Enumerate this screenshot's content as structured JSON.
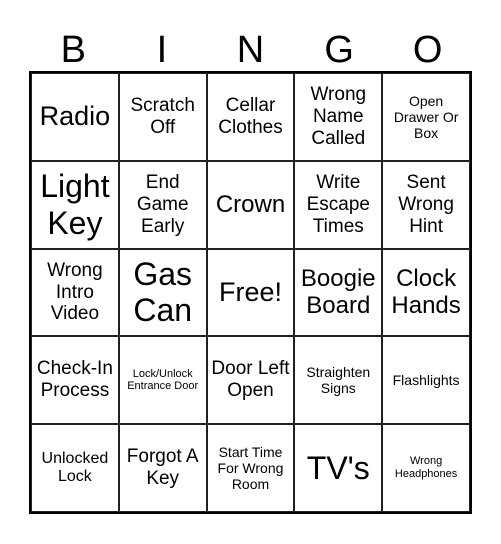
{
  "header": [
    "B",
    "I",
    "N",
    "G",
    "O"
  ],
  "cells": [
    [
      {
        "text": "Radio",
        "size": "s-l"
      },
      {
        "text": "Scratch Off",
        "size": "s-s"
      },
      {
        "text": "Cellar Clothes",
        "size": "s-s"
      },
      {
        "text": "Wrong Name Called",
        "size": "s-s"
      },
      {
        "text": "Open Drawer Or Box",
        "size": "s-xxs"
      }
    ],
    [
      {
        "text": "Light Key",
        "size": "s-xl"
      },
      {
        "text": "End Game Early",
        "size": "s-s"
      },
      {
        "text": "Crown",
        "size": "s-ml"
      },
      {
        "text": "Write Escape Times",
        "size": "s-s"
      },
      {
        "text": "Sent Wrong Hint",
        "size": "s-s"
      }
    ],
    [
      {
        "text": "Wrong Intro Video",
        "size": "s-s"
      },
      {
        "text": "Gas Can",
        "size": "s-xl"
      },
      {
        "text": "Free!",
        "size": "s-l"
      },
      {
        "text": "Boogie Board",
        "size": "s-ml"
      },
      {
        "text": "Clock Hands",
        "size": "s-ml"
      }
    ],
    [
      {
        "text": "Check-In Process",
        "size": "s-s"
      },
      {
        "text": "Lock/Unlock Entrance Door",
        "size": "s-micro"
      },
      {
        "text": "Door Left Open",
        "size": "s-s"
      },
      {
        "text": "Straighten Signs",
        "size": "s-xxs"
      },
      {
        "text": "Flashlights",
        "size": "s-xxs"
      }
    ],
    [
      {
        "text": "Unlocked Lock",
        "size": "s-xs"
      },
      {
        "text": "Forgot A Key",
        "size": "s-s"
      },
      {
        "text": "Start Time For Wrong Room",
        "size": "s-xxs"
      },
      {
        "text": "TV's",
        "size": "s-xl"
      },
      {
        "text": "Wrong Headphones",
        "size": "s-micro"
      }
    ]
  ]
}
